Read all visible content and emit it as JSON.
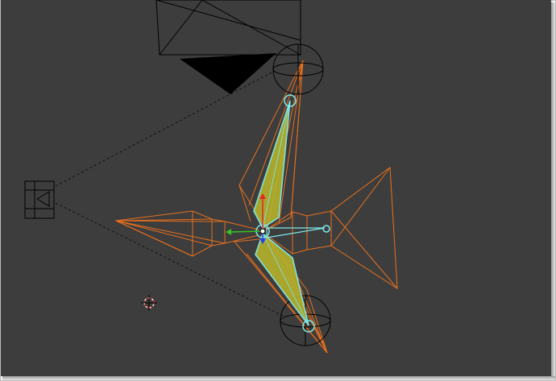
{
  "viewport": {
    "background": "#3d3d3d",
    "colors": {
      "selected_wire": "#e8701e",
      "bone_fill": "#b5b12c",
      "bone_outline": "#7fe8e8",
      "wire_black": "#000000",
      "axis_x": "#e8242a",
      "axis_y": "#36c424",
      "axis_z": "#2540e0",
      "cursor_red": "#d83030"
    },
    "icons": {
      "lamp": "lamp-icon",
      "camera": "camera-icon",
      "cursor": "3d-cursor-icon",
      "transform_widget": "transform-gizmo-icon"
    }
  }
}
